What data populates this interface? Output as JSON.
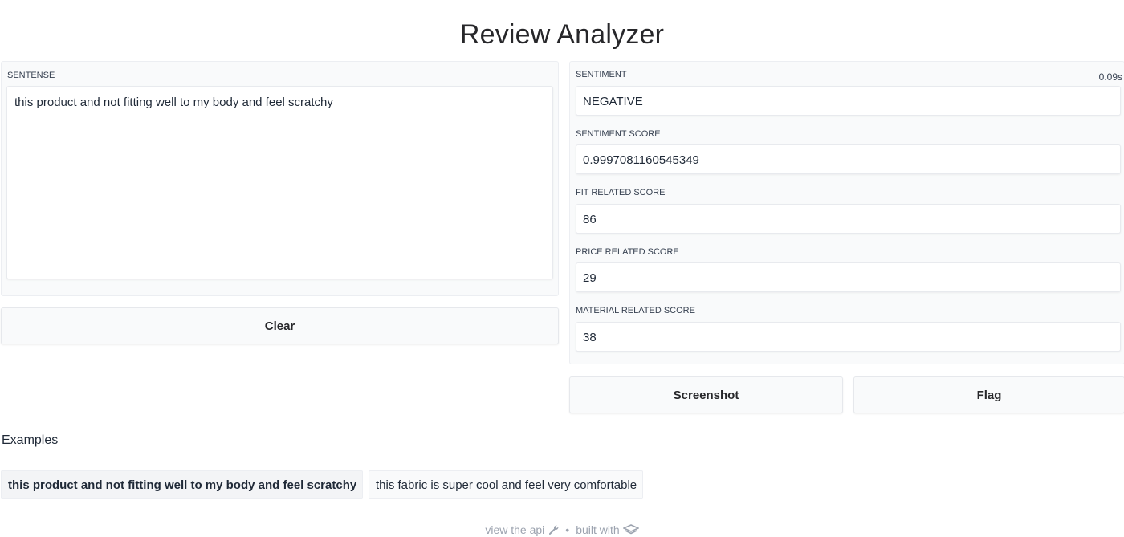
{
  "page": {
    "title": "Review Analyzer"
  },
  "input": {
    "label": "SENTENSE",
    "value": "this product and not fitting well to my body and feel scratchy"
  },
  "buttons": {
    "clear": "Clear",
    "screenshot": "Screenshot",
    "flag": "Flag"
  },
  "output": {
    "timing": "0.09s",
    "fields": [
      {
        "label": "SENTIMENT",
        "value": "NEGATIVE"
      },
      {
        "label": "SENTIMENT SCORE",
        "value": "0.9997081160545349"
      },
      {
        "label": "FIT RELATED SCORE",
        "value": "86"
      },
      {
        "label": "PRICE RELATED SCORE",
        "value": "29"
      },
      {
        "label": "MATERIAL RELATED SCORE",
        "value": "38"
      }
    ]
  },
  "examples": {
    "title": "Examples",
    "items": [
      "this product and not fitting well to my body and feel scratchy",
      "this fabric is super cool and feel very comfortable"
    ]
  },
  "footer": {
    "api_link": "view the api",
    "api_icon": "wrench-icon",
    "separator": "•",
    "built_with": "built with",
    "logo_icon": "gradio-logo-icon"
  }
}
